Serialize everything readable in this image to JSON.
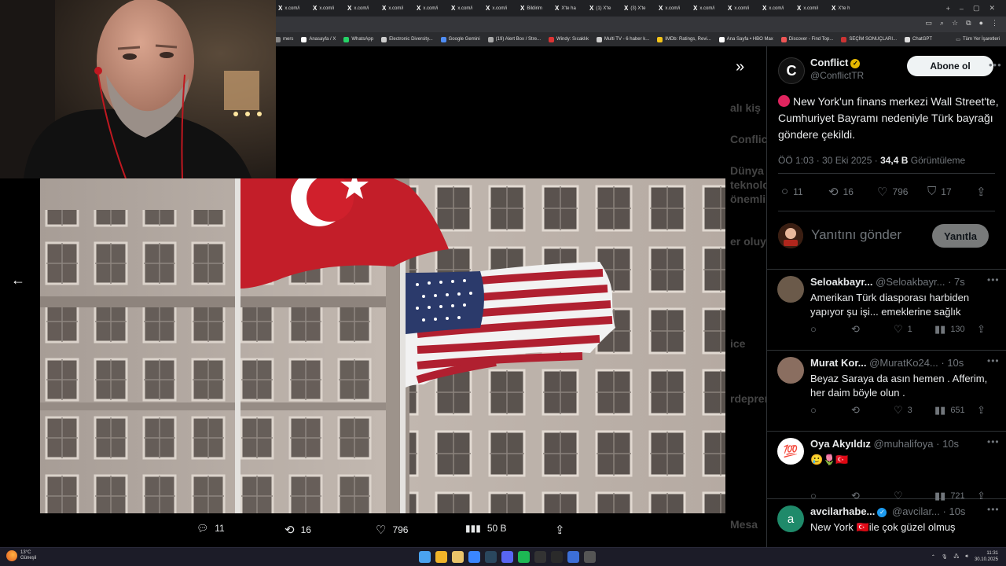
{
  "browser": {
    "tabs": [
      {
        "label": "x.com/i",
        "icon": "x-logo"
      },
      {
        "label": "x.com/i",
        "icon": "x-logo"
      },
      {
        "label": "x.com/i",
        "icon": "x-logo"
      },
      {
        "label": "x.com/i",
        "icon": "x-logo"
      },
      {
        "label": "x.com/i",
        "icon": "x-logo"
      },
      {
        "label": "x.com/i",
        "icon": "x-logo"
      },
      {
        "label": "x.com/i",
        "icon": "x-logo"
      },
      {
        "label": "Bildirim",
        "icon": "x-logo"
      },
      {
        "label": "X'te ha",
        "icon": "x-logo"
      },
      {
        "label": "(1) X'te",
        "icon": "x-logo"
      },
      {
        "label": "(3) X'te",
        "icon": "x-logo"
      },
      {
        "label": "x.com/i",
        "icon": "x-logo"
      },
      {
        "label": "x.com/i",
        "icon": "x-logo"
      },
      {
        "label": "x.com/i",
        "icon": "x-logo"
      },
      {
        "label": "x.com/i",
        "icon": "x-logo"
      },
      {
        "label": "x.com/i",
        "icon": "x-logo"
      },
      {
        "label": "X'te h",
        "icon": "x-logo"
      }
    ],
    "bookmarks": [
      {
        "label": "mers",
        "color": "#888"
      },
      {
        "label": "Anasayfa / X",
        "color": "#fff"
      },
      {
        "label": "WhatsApp",
        "color": "#25d366"
      },
      {
        "label": "Electronic Diversity...",
        "color": "#ccc"
      },
      {
        "label": "Google Gemini",
        "color": "#4f8df5"
      },
      {
        "label": "(19) Alert Box / Stre...",
        "color": "#aaa"
      },
      {
        "label": "Windy: Sıcaklık",
        "color": "#d33"
      },
      {
        "label": "Multi TV - 6 haber k...",
        "color": "#ccc"
      },
      {
        "label": "IMDb: Ratings, Revi...",
        "color": "#f5c518"
      },
      {
        "label": "Ana Sayfa • HBO Max",
        "color": "#fff"
      },
      {
        "label": "Discover - Find Top...",
        "color": "#e55"
      },
      {
        "label": "SEÇİM SONUÇLARI...",
        "color": "#c33"
      },
      {
        "label": "ChatGPT",
        "color": "#ddd"
      }
    ],
    "bookmarks_all": "Tüm Yer İşaretleri"
  },
  "post": {
    "name": "Conflict",
    "handle": "@ConflictTR",
    "follow_label": "Abone ol",
    "text": "New York'un finans merkezi Wall Street'te, Cumhuriyet Bayramı nedeniyle Türk bayrağı göndere çekildi.",
    "time": "ÖÖ 1:03 · 30 Eki 2025 · ",
    "views": "34,4 B",
    "views_label": " Görüntüleme",
    "replies": "11",
    "reposts": "16",
    "likes": "796",
    "bookmarks": "17",
    "reply_placeholder": "Yanıtını gönder",
    "reply_button": "Yanıtla"
  },
  "modal": {
    "replies": "11",
    "reposts": "16",
    "likes": "796",
    "views": "50 B"
  },
  "comments": [
    {
      "name": "Seloakbayr...",
      "handle": "@Seloakbayr...",
      "time": "· 7s",
      "text": "Amerikan Türk diasporası harbiden yapıyor şu işi... emeklerine sağlık",
      "likes": "1",
      "views": "130",
      "avatar_color": "#6b5a4a"
    },
    {
      "name": "Murat Kor...",
      "handle": "@MuratKo24...",
      "time": "· 10s",
      "text": "Beyaz Saraya da asın hemen . Afferim, her daim böyle olun .",
      "likes": "3",
      "views": "651",
      "avatar_color": "#8a6e60"
    },
    {
      "name": "Oya Akyıldız",
      "handle": "@muhalifoya",
      "time": "· 10s",
      "text": "🥲🌷🇹🇷",
      "likes": "",
      "views": "721",
      "avatar_label": "💯",
      "avatar_color": "#fff"
    },
    {
      "name": "avcilarhabe...",
      "handle": "@avcilar...",
      "time": "· 10s",
      "text": "New York 🇹🇷ile çok güzel olmuş",
      "likes": "",
      "views": "",
      "avatar_label": "a",
      "avatar_color": "#1f8a6a"
    }
  ],
  "ghost_feed": [
    "alı kiş",
    "Conflic",
    "Dünya",
    "teknolo",
    "önemli",
    "er oluy",
    "ice",
    "rdeprem",
    "Mesa"
  ],
  "taskbar": {
    "weather_temp": "13°C",
    "weather_desc": "Güneşli",
    "time": "11:31",
    "date": "30.10.2025"
  }
}
